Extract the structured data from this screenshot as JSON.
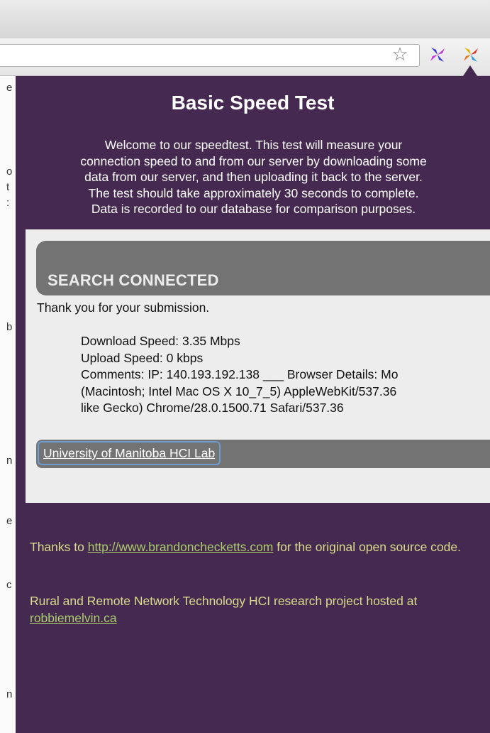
{
  "browser": {
    "bookmark_icon": "star-icon",
    "extension_icons": [
      "pinwheel-extension-icon",
      "pinwheel-extension-icon-active"
    ],
    "left_edge_glyphs": [
      "e",
      "o",
      "t",
      ":",
      "b",
      "n",
      "e",
      "c",
      "n"
    ]
  },
  "popup": {
    "background_color": "#452950",
    "title": "Basic Speed Test",
    "intro_lines": [
      "Welcome to our speedtest. This test will measure your",
      "connection speed to and from our server by downloading some",
      "data from our server, and then uploading it back to the server.",
      "The test should take approximately 30 seconds to complete.",
      "Data is recorded to our database for comparison purposes."
    ],
    "result": {
      "header": "SEARCH CONNECTED",
      "thanks": "Thank you for your submission.",
      "download": "Download Speed: 3.35 Mbps",
      "upload": "Upload Speed: 0 kbps",
      "comments_lines": [
        "Comments: IP: 140.193.192.138 ___ Browser Details: Mo",
        "(Macintosh; Intel Mac OS X 10_7_5) AppleWebKit/537.36",
        "like Gecko) Chrome/28.0.1500.71 Safari/537.36"
      ],
      "lab_link": "University of Manitoba HCI Lab"
    },
    "footer": {
      "thanks_prefix": "Thanks to ",
      "thanks_link": "http://www.brandonchecketts.com",
      "thanks_suffix": " for the original open source code.",
      "hosted_prefix": "Rural and Remote Network Technology HCI research project hosted at ",
      "hosted_link": "robbiemelvin.ca"
    }
  }
}
